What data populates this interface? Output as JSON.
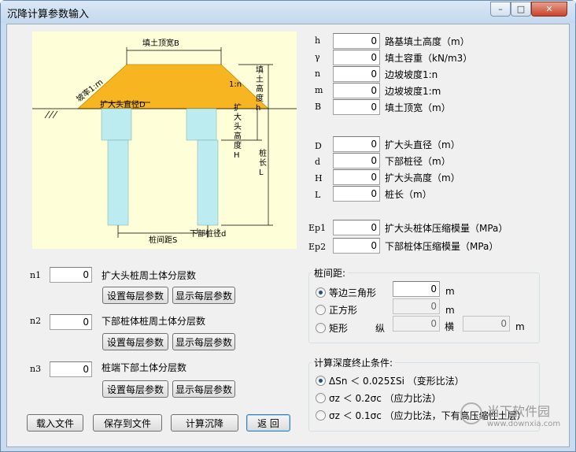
{
  "window": {
    "title": "沉降计算参数输入",
    "controls": {
      "minimize": "–",
      "maximize": "□",
      "close": "✕"
    }
  },
  "diagram": {
    "label_top_width": "填土顶宽B",
    "label_slope_left": "坡率1:m",
    "label_slope_right": "1:n",
    "label_fill_height": "填土高度h",
    "label_head_diameter": "扩大头直径D",
    "label_head_height": "扩大头高度H",
    "label_pile_length": "桩长L",
    "label_pile_spacing": "桩间距S",
    "label_pile_diameter": "下部桩径d"
  },
  "params_top": [
    {
      "symbol": "h",
      "value": "0",
      "label": "路基填土高度（m）"
    },
    {
      "symbol": "γ",
      "value": "0",
      "label": "填土容重（kN/m3）"
    },
    {
      "symbol": "n",
      "value": "0",
      "label": "边坡坡度1:n"
    },
    {
      "symbol": "m",
      "value": "0",
      "label": "边坡坡度1:m"
    },
    {
      "symbol": "B",
      "value": "0",
      "label": "填土顶宽（m）"
    }
  ],
  "params_mid": [
    {
      "symbol": "D",
      "value": "0",
      "label": "扩大头直径（m）"
    },
    {
      "symbol": "d",
      "value": "0",
      "label": "下部桩径（m）"
    },
    {
      "symbol": "H",
      "value": "0",
      "label": "扩大头高度（m）"
    },
    {
      "symbol": "L",
      "value": "0",
      "label": "桩长（m）"
    }
  ],
  "params_modulus": [
    {
      "symbol": "Ep1",
      "value": "0",
      "label": "扩大头桩体压缩模量（MPa）"
    },
    {
      "symbol": "Ep2",
      "value": "0",
      "label": "下部桩体压缩模量（MPa）"
    }
  ],
  "layers": [
    {
      "symbol": "n1",
      "value": "0",
      "label": "扩大头桩周土体分层数",
      "set_label": "设置每层参数",
      "show_label": "显示每层参数"
    },
    {
      "symbol": "n2",
      "value": "0",
      "label": "下部桩体桩周土体分层数",
      "set_label": "设置每层参数",
      "show_label": "显示每层参数"
    },
    {
      "symbol": "n3",
      "value": "0",
      "label": "桩端下部土体分层数",
      "set_label": "设置每层参数",
      "show_label": "显示每层参数"
    }
  ],
  "spacing": {
    "title": "桩间距:",
    "options": [
      {
        "label": "等边三角形",
        "selected": true,
        "value": "0",
        "unit": "m"
      },
      {
        "label": "正方形",
        "selected": false,
        "value": "0",
        "unit": "m"
      },
      {
        "label": "矩形",
        "selected": false,
        "lon_label": "纵",
        "lon_value": "0",
        "lat_label": "横",
        "lat_value": "0",
        "unit": "m"
      }
    ]
  },
  "termination": {
    "title": "计算深度终止条件:",
    "options": [
      {
        "label": "ΔSn ＜ 0.025ΣSi （变形比法）",
        "selected": true
      },
      {
        "label": "σz ＜ 0.2σc （应力比法）",
        "selected": false
      },
      {
        "label": "σz ＜ 0.1σc （应力比法，下有高压缩性土层）",
        "selected": false
      }
    ]
  },
  "buttons": {
    "load": "载入文件",
    "save": "保存到文件",
    "calc": "计算沉降",
    "back": "返 回"
  },
  "watermark": {
    "brand": "当下软件园",
    "url": "www.downxia.com"
  },
  "colors": {
    "fill": "#f6b521",
    "pile": "#bcecf0",
    "diagram_bg": "#fefed8"
  }
}
